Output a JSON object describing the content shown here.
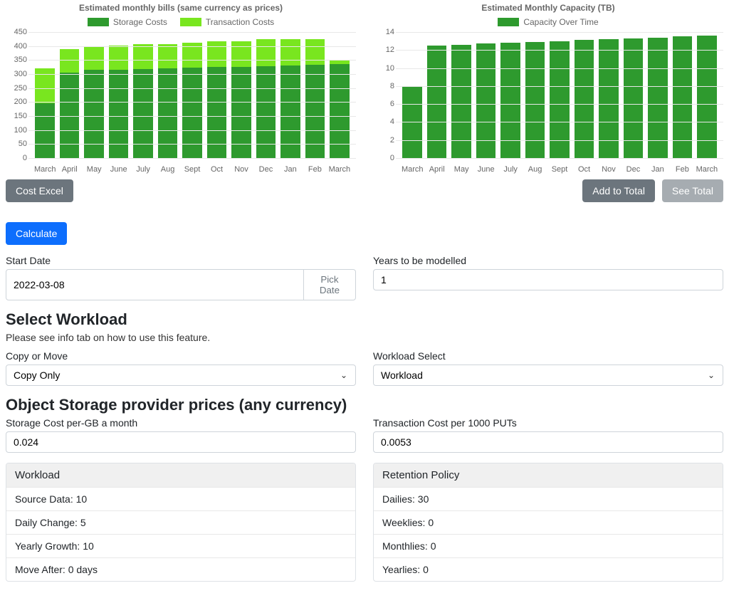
{
  "chart_data": [
    {
      "type": "bar",
      "title": "Estimated monthly bills (same currency as prices)",
      "stacked": true,
      "ylim": [
        0,
        450
      ],
      "y_ticks": [
        0,
        50,
        100,
        150,
        200,
        250,
        300,
        350,
        400,
        450
      ],
      "categories": [
        "March",
        "April",
        "May",
        "June",
        "July",
        "Aug",
        "Sept",
        "Oct",
        "Nov",
        "Dec",
        "Jan",
        "Feb",
        "March"
      ],
      "series": [
        {
          "name": "Storage Costs",
          "color": "#2e9a2e",
          "values": [
            195,
            305,
            315,
            315,
            318,
            320,
            322,
            325,
            326,
            328,
            330,
            332,
            335
          ]
        },
        {
          "name": "Transaction Costs",
          "color": "#79e61f",
          "values": [
            125,
            85,
            85,
            87,
            88,
            88,
            89,
            92,
            92,
            96,
            95,
            92,
            15
          ]
        }
      ]
    },
    {
      "type": "bar",
      "title": "Estimated Monthly Capacity (TB)",
      "stacked": false,
      "ylim": [
        0,
        14
      ],
      "y_ticks": [
        0,
        2,
        4,
        6,
        8,
        10,
        12,
        14
      ],
      "categories": [
        "March",
        "April",
        "May",
        "June",
        "July",
        "Aug",
        "Sept",
        "Oct",
        "Nov",
        "Dec",
        "Jan",
        "Feb",
        "March"
      ],
      "series": [
        {
          "name": "Capacity Over Time",
          "color": "#2e9a2e",
          "values": [
            8.0,
            12.5,
            12.6,
            12.7,
            12.8,
            12.9,
            13.0,
            13.1,
            13.2,
            13.3,
            13.4,
            13.5,
            13.6
          ]
        }
      ]
    }
  ],
  "buttons": {
    "cost_excel": "Cost Excel",
    "add_to_total": "Add to Total",
    "see_total": "See Total",
    "calculate": "Calculate",
    "pick_date": "Pick Date"
  },
  "labels": {
    "start_date": "Start Date",
    "years": "Years to be modelled",
    "select_workload_heading": "Select Workload",
    "select_workload_hint": "Please see info tab on how to use this feature.",
    "copy_or_move": "Copy or Move",
    "workload_select": "Workload Select",
    "pricing_heading": "Object Storage provider prices (any currency)",
    "storage_cost": "Storage Cost per-GB a month",
    "transaction_cost": "Transaction Cost per 1000 PUTs"
  },
  "values": {
    "start_date": "2022-03-08",
    "years": "1",
    "copy_or_move": "Copy Only",
    "workload_select": "Workload",
    "storage_cost": "0.024",
    "transaction_cost": "0.0053"
  },
  "cards": {
    "workload": {
      "heading": "Workload",
      "items": [
        "Source Data: 10",
        "Daily Change: 5",
        "Yearly Growth: 10",
        "Move After: 0 days"
      ]
    },
    "retention": {
      "heading": "Retention Policy",
      "items": [
        "Dailies: 30",
        "Weeklies: 0",
        "Monthlies: 0",
        "Yearlies: 0"
      ]
    }
  }
}
